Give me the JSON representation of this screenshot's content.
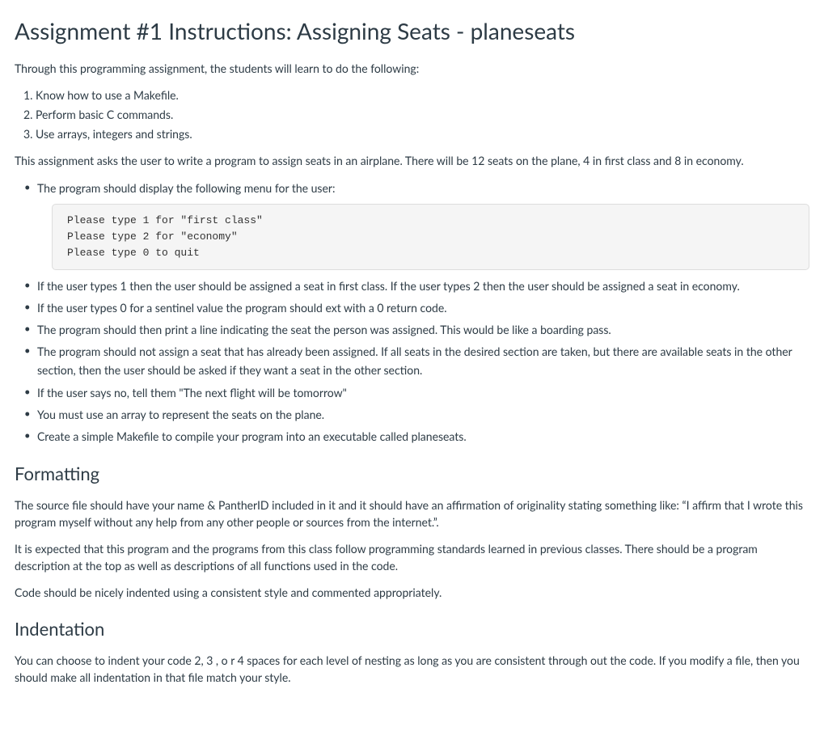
{
  "title": "Assignment #1 Instructions: Assigning Seats - planeseats",
  "intro": "Through this programming assignment, the students will learn to do the following:",
  "objectives": [
    "Know how to use a Makefile.",
    "Perform basic C commands.",
    "Use arrays, integers and strings."
  ],
  "description": "This assignment asks the user to write a program to assign seats in  an airplane. There will be 12 seats on the plane, 4 in first class and 8 in economy.",
  "req_menu_intro": " The program should display the following menu for the user:",
  "menu_code": "Please type 1 for \"first class\"\nPlease type 2 for \"economy\"\nPlease type 0 to quit",
  "requirements_rest": [
    "If the user types 1 then the user should be assigned a seat in first class. If the user types 2 then the user should be assigned a seat in economy.",
    "If the user types 0 for a sentinel value the program should ext with a 0 return code.",
    "The program should then print a line indicating the seat the person was assigned. This would be like a boarding pass.",
    "The program should not assign a seat that has already been assigned. If all seats in the desired section are taken, but there are available seats in the other section, then the user should be asked if they want a seat in the other section.",
    "If the user says no, tell them \"The next flight will be tomorrow\"",
    "You must use an array to represent the seats on the plane.",
    "Create a simple Makefile to compile your program into an executable called planeseats."
  ],
  "formatting": {
    "heading": "Formatting",
    "p1": "The source file should have your name & PantherID included in it and it should have an affirmation of originality stating something like: “I affirm that I wrote this program myself without any help from any other people or sources from the internet.”.",
    "p2": "It is expected that this program and the programs from this class follow programming standards learned in previous classes. There should be a program description at the top as well as descriptions of all functions used in the code.",
    "p3": "Code should be nicely indented using a consistent style and commented appropriately."
  },
  "indentation": {
    "heading": "Indentation",
    "p1": "You can choose to indent your code 2, 3 , o r 4 spaces for each level of nesting as long as you are consistent through out the code. If you modify a file, then you should make all indentation in that file match your style."
  }
}
